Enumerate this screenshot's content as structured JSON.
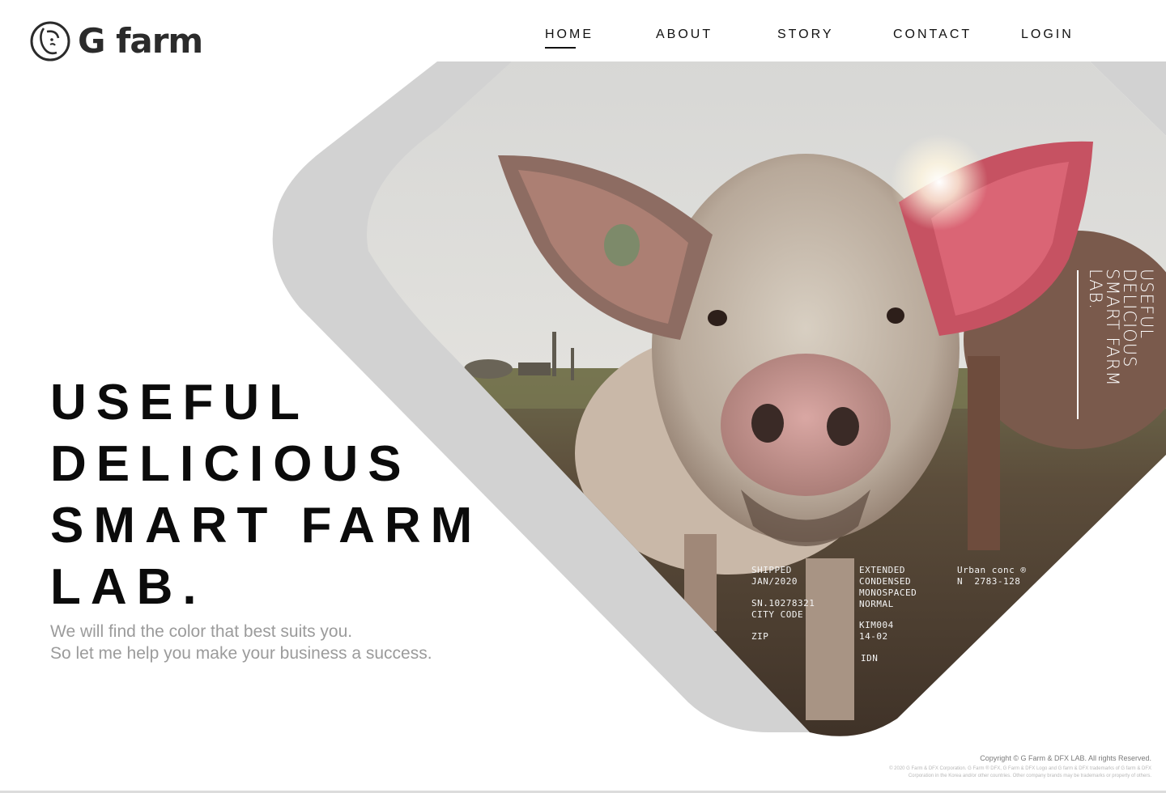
{
  "brand": {
    "name": "G farm",
    "logo_icon": "pig-face-icon"
  },
  "nav": {
    "items": [
      {
        "label": "HOME",
        "active": true
      },
      {
        "label": "ABOUT",
        "active": false
      },
      {
        "label": "STORY",
        "active": false
      },
      {
        "label": "CONTACT",
        "active": false
      },
      {
        "label": "LOGIN",
        "active": false
      }
    ]
  },
  "hero": {
    "headline": [
      "USEFUL",
      "DELICIOUS",
      "SMART FARM",
      "LAB."
    ],
    "subtext": [
      "We will find the color that best suits you.",
      "So let me help you make your business a success."
    ],
    "vertical_text": [
      "USEFUL",
      "DELICIOUS",
      "SMART FARM",
      "LAB."
    ],
    "photo_subject": "pig photo",
    "specs": {
      "col1_a": "SHIPPED\nJAN/2020",
      "col1_b": "SN.10278321\nCITY CODE",
      "col1_c": "ZIP",
      "col2_a": "EXTENDED\nCONDENSED\nMONOSPACED\nNORMAL",
      "col2_b": "KIM004\n14-02",
      "col2_c": "IDN",
      "col3_a": "Urban conc ®\nN  2783-128"
    }
  },
  "footer": {
    "copyright": "Copyright © G Farm & DFX LAB. All rights Reserved.",
    "fine_print": [
      "© 2020 G Farm & DFX Corporation. G Farm ® DFX, G Farm & DFX Logo and G farm & DFX trademarks of G farm & DFX",
      "Corporation in the Korea and/or other countries. Other company brands may be trademarks or property of others."
    ]
  },
  "colors": {
    "accent": "#111111",
    "shape_gray": "#d2d2d2",
    "text_gray": "#9b9b9b"
  }
}
